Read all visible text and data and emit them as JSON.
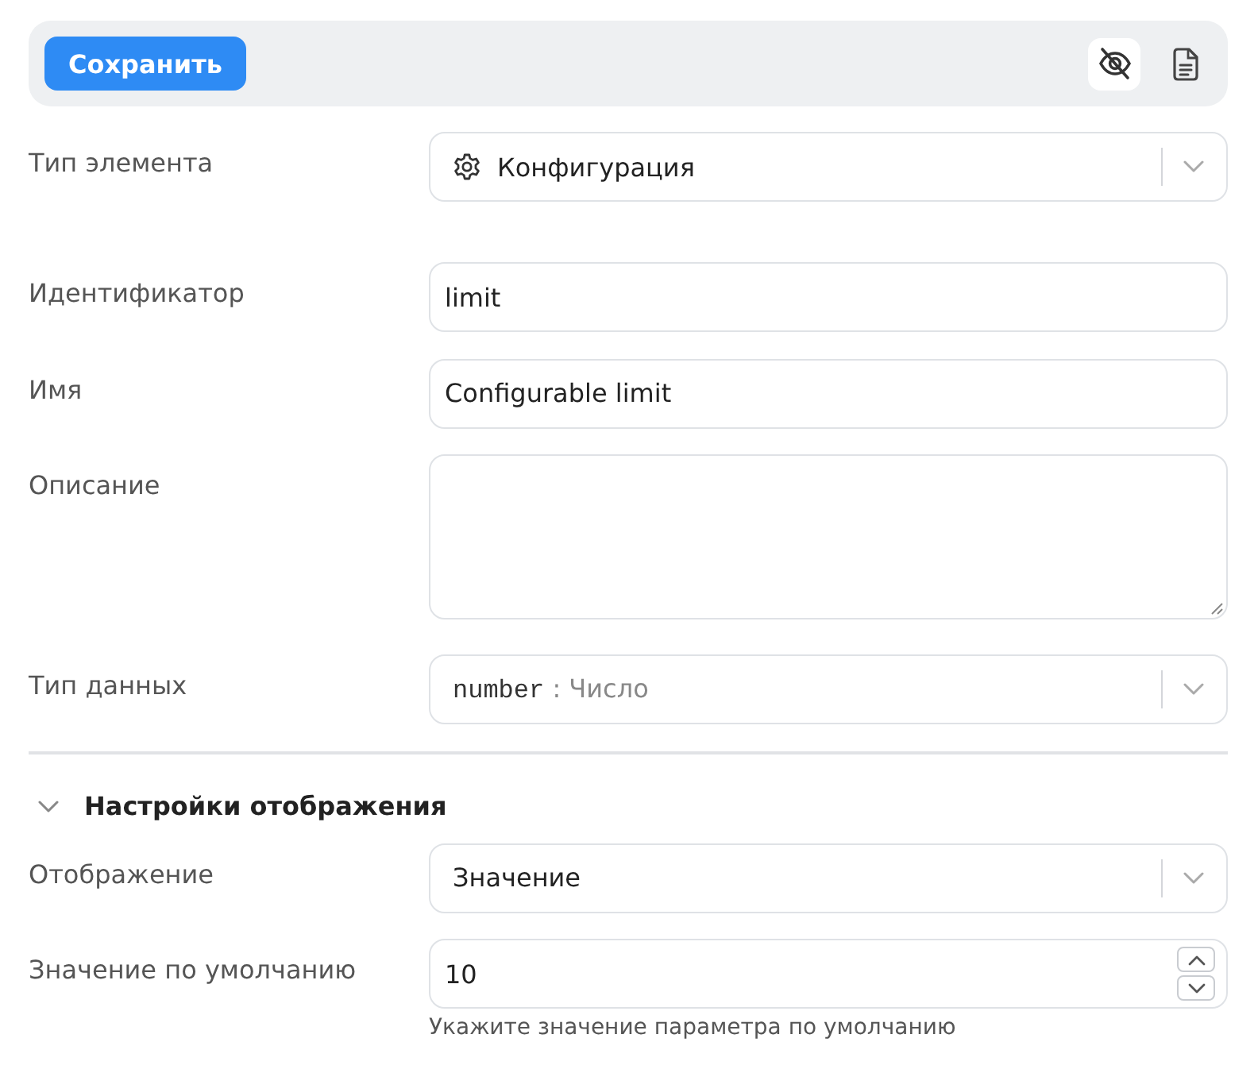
{
  "toolbar": {
    "save_button": "Сохранить",
    "tools": [
      {
        "kind": "visibility",
        "selected": true
      },
      {
        "kind": "document",
        "selected": false
      }
    ]
  },
  "element_type": {
    "label": "Тип элемента",
    "value": "Конфигурация"
  },
  "fields": [
    {
      "kind": "text",
      "label": "Идентификатор",
      "value": "limit"
    },
    {
      "kind": "text",
      "label": "Имя",
      "value": "Configurable limit"
    },
    {
      "kind": "textarea",
      "label": "Описание"
    },
    {
      "kind": "select",
      "label": "Тип данных",
      "code": "number",
      "value": ": Число"
    }
  ],
  "display_settings": {
    "title": "Настройки отображения",
    "expanded": true,
    "fields": [
      {
        "kind": "select",
        "label": "Отображение",
        "value": "Значение"
      },
      {
        "kind": "number",
        "label": "Значение по умолчанию",
        "value": "10",
        "hint": "Укажите значение параметра по умолчанию"
      }
    ]
  }
}
